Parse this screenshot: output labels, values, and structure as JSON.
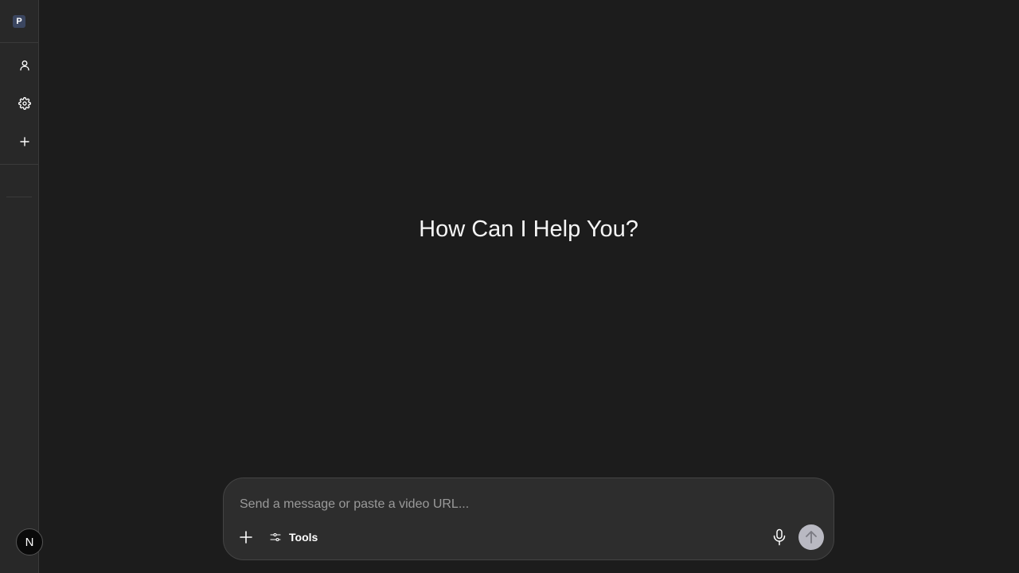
{
  "sidebar": {
    "logo_letter": "P",
    "items": [
      {
        "icon": "user-icon"
      },
      {
        "icon": "gear-icon"
      },
      {
        "icon": "plus-icon"
      }
    ],
    "avatar_initial": "N"
  },
  "main": {
    "heading": "How Can I Help You?"
  },
  "composer": {
    "placeholder": "Send a message or paste a video URL...",
    "value": "",
    "tools_label": "Tools"
  },
  "colors": {
    "background": "#1c1c1c",
    "sidebar": "#282828",
    "composer": "#2d2d2d",
    "send_button": "#b9b9c2"
  }
}
